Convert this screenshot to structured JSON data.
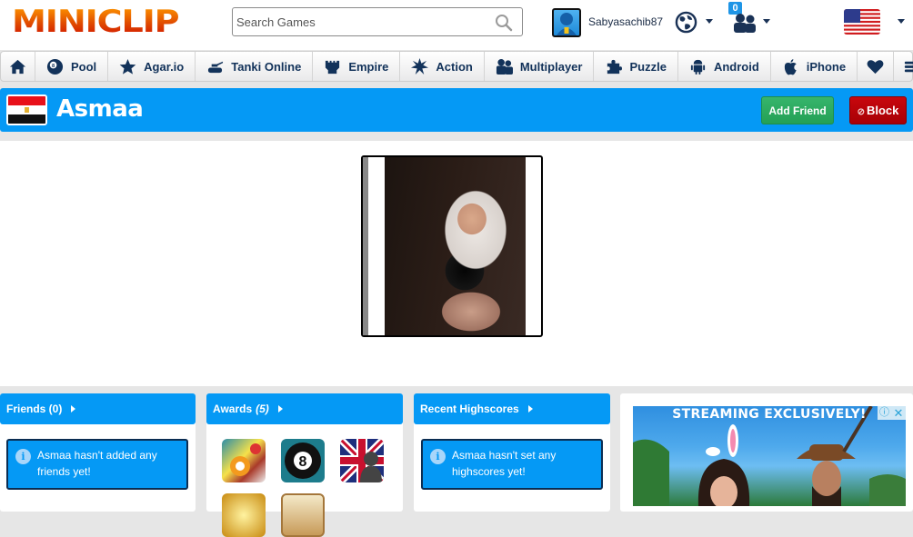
{
  "header": {
    "logo": "MINICLIP",
    "search": {
      "placeholder": "Search Games",
      "value": ""
    },
    "user": {
      "username": "Sabyasachib87"
    },
    "friend_requests_count": "0",
    "language": "US"
  },
  "nav": {
    "items": [
      {
        "label": "",
        "icon": "home-icon"
      },
      {
        "label": "Pool",
        "icon": "pool-ball-icon"
      },
      {
        "label": "Agar.io",
        "icon": "star-icon"
      },
      {
        "label": "Tanki Online",
        "icon": "tank-icon"
      },
      {
        "label": "Empire",
        "icon": "castle-icon"
      },
      {
        "label": "Action",
        "icon": "explosion-icon"
      },
      {
        "label": "Multiplayer",
        "icon": "users-icon"
      },
      {
        "label": "Puzzle",
        "icon": "puzzle-icon"
      },
      {
        "label": "Android",
        "icon": "android-icon"
      },
      {
        "label": "iPhone",
        "icon": "apple-icon"
      },
      {
        "label": "",
        "icon": "heart-icon"
      },
      {
        "label": "",
        "icon": "menu-icon"
      }
    ]
  },
  "profile": {
    "name": "Asmaa",
    "country": "Egypt",
    "add_friend_label": "Add Friend",
    "block_label": "Block",
    "block_icon": "⊘"
  },
  "panels": {
    "friends": {
      "title": "Friends (0)",
      "message": "Asmaa hasn't added any friends yet!"
    },
    "awards": {
      "title": "Awards",
      "count": "(5)",
      "items": [
        "8 Ball Pool Win",
        "8 Ball",
        "UK Player",
        "Gold Medal",
        "Trophy"
      ]
    },
    "highscores": {
      "title": "Recent Highscores",
      "message": "Asmaa hasn't set any highscores yet!"
    }
  },
  "ad": {
    "headline": "STREAMING EXCLUSIVELY!",
    "info_icon": "ⓘ",
    "close_icon": "✕"
  },
  "colors": {
    "brand_blue": "#0599f5",
    "nav_text": "#12325a",
    "add_friend_green": "#2aa85d",
    "block_red": "#c0060b"
  }
}
